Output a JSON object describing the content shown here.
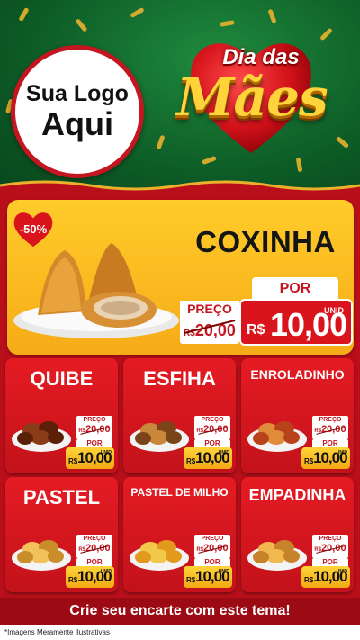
{
  "logo": {
    "line1": "Sua Logo",
    "line2": "Aqui"
  },
  "banner": {
    "line1": "Dia das",
    "line2": "Mães"
  },
  "featured": {
    "discount": "-50%",
    "name": "COXINHA",
    "preco_label": "PREÇO",
    "old_currency": "R$",
    "old_price": "20,00",
    "por_label": "POR",
    "unid_label": "UNID",
    "currency": "R$",
    "price": "10,00"
  },
  "products": [
    {
      "name": "QUIBE",
      "preco_label": "PREÇO",
      "old_currency": "R$",
      "old_price": "20,00",
      "por_label": "POR",
      "unid_label": "UNID",
      "currency": "R$",
      "price": "10,00"
    },
    {
      "name": "ESFIHA",
      "preco_label": "PREÇO",
      "old_currency": "R$",
      "old_price": "20,00",
      "por_label": "POR",
      "unid_label": "UNID",
      "currency": "R$",
      "price": "10,00"
    },
    {
      "name": "ENROLADINHO",
      "preco_label": "PREÇO",
      "old_currency": "R$",
      "old_price": "20,00",
      "por_label": "POR",
      "unid_label": "UNID",
      "currency": "R$",
      "price": "10,00"
    },
    {
      "name": "PASTEL",
      "preco_label": "PREÇO",
      "old_currency": "R$",
      "old_price": "20,00",
      "por_label": "POR",
      "unid_label": "UNID",
      "currency": "R$",
      "price": "10,00"
    },
    {
      "name": "PASTEL DE MILHO",
      "preco_label": "PREÇO",
      "old_currency": "R$",
      "old_price": "20,00",
      "por_label": "POR",
      "unid_label": "UNID",
      "currency": "R$",
      "price": "10,00"
    },
    {
      "name": "EMPADINHA",
      "preco_label": "PREÇO",
      "old_currency": "R$",
      "old_price": "20,00",
      "por_label": "POR",
      "unid_label": "UNID",
      "currency": "R$",
      "price": "10,00"
    }
  ],
  "cta": "Crie seu encarte com este tema!",
  "disclaimer": "*Imagens Meramente Ilustrativas",
  "colors": {
    "header_green": "#0d5c26",
    "brand_red": "#c41620",
    "gold": "#ffd43a",
    "featured_yellow": "#f6ab18"
  }
}
